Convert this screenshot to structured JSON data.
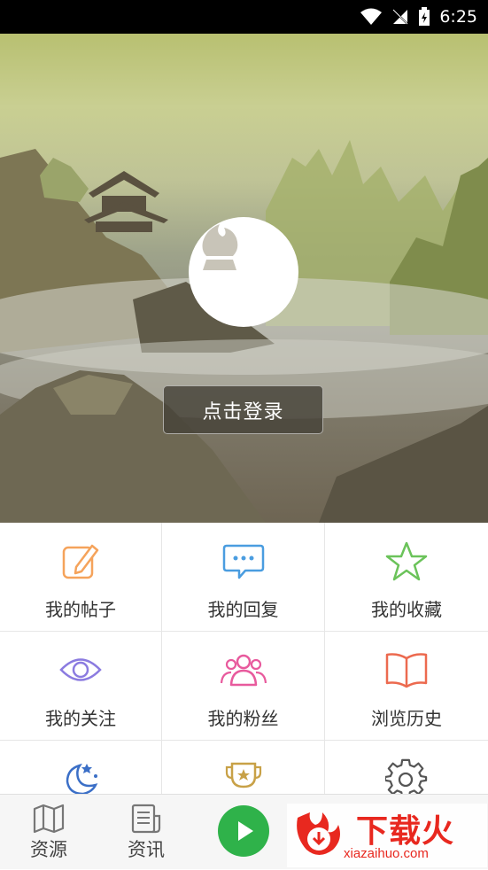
{
  "status_bar": {
    "time": "6:25"
  },
  "hero": {
    "login_label": "点击登录"
  },
  "menu": [
    {
      "label": "我的帖子",
      "icon": "edit-icon",
      "color": "#f5a35b"
    },
    {
      "label": "我的回复",
      "icon": "chat-bubble-icon",
      "color": "#4a9de0"
    },
    {
      "label": "我的收藏",
      "icon": "star-icon",
      "color": "#6bc35a"
    },
    {
      "label": "我的关注",
      "icon": "eye-icon",
      "color": "#8b7be0"
    },
    {
      "label": "我的粉丝",
      "icon": "users-icon",
      "color": "#e85a9d"
    },
    {
      "label": "浏览历史",
      "icon": "book-icon",
      "color": "#ec6a4f"
    },
    {
      "label": "",
      "icon": "night-mode-icon",
      "color": "#3b6fc7"
    },
    {
      "label": "",
      "icon": "trophy-icon",
      "color": "#c8a147"
    },
    {
      "label": "",
      "icon": "gear-icon",
      "color": "#555555"
    }
  ],
  "bottom_nav": {
    "tabs": [
      {
        "label": "资源",
        "icon": "map-icon"
      },
      {
        "label": "资讯",
        "icon": "news-icon"
      }
    ],
    "play_icon": "play-icon",
    "watermark": {
      "title": "下载火",
      "url": "xiazaihuo.com"
    }
  }
}
